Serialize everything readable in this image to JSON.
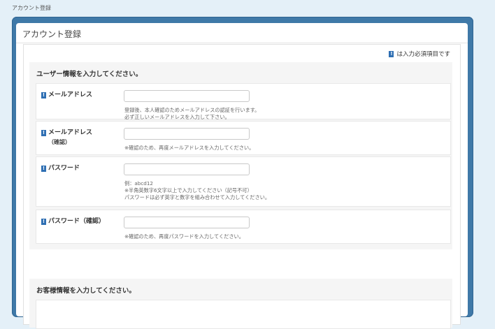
{
  "breadcrumb": "アカウント登録",
  "panel_title": "アカウント登録",
  "legend": {
    "badge": "!",
    "text": "は入力必須項目です"
  },
  "section1": {
    "heading": "ユーザー情報を入力してください。",
    "fields": [
      {
        "label": "メールアドレス",
        "sublabel": "",
        "value": "",
        "help": [
          "登録後、本人確認のためメールアドレスの認証を行います。",
          "必ず正しいメールアドレスを入力して下さい。"
        ]
      },
      {
        "label": "メールアドレス",
        "sublabel": "（確認）",
        "value": "",
        "help": [
          "※確認のため、再度メールアドレスを入力してください。"
        ]
      },
      {
        "label": "パスワード",
        "sublabel": "",
        "value": "",
        "help": [
          "例：abcd12",
          "※半角英数字6文字以上で入力してください（記号不可）",
          "パスワードは必ず英字と数字を組み合わせて入力してください。"
        ]
      },
      {
        "label": "パスワード（確認）",
        "sublabel": "",
        "value": "",
        "help": [
          "※確認のため、再度パスワードを入力してください。"
        ]
      }
    ]
  },
  "section2": {
    "heading": "お客様情報を入力してください。"
  },
  "colors": {
    "frame": "#3f79a8",
    "required_badge": "#2f6fb3",
    "section_bg": "#f5f5f5"
  }
}
